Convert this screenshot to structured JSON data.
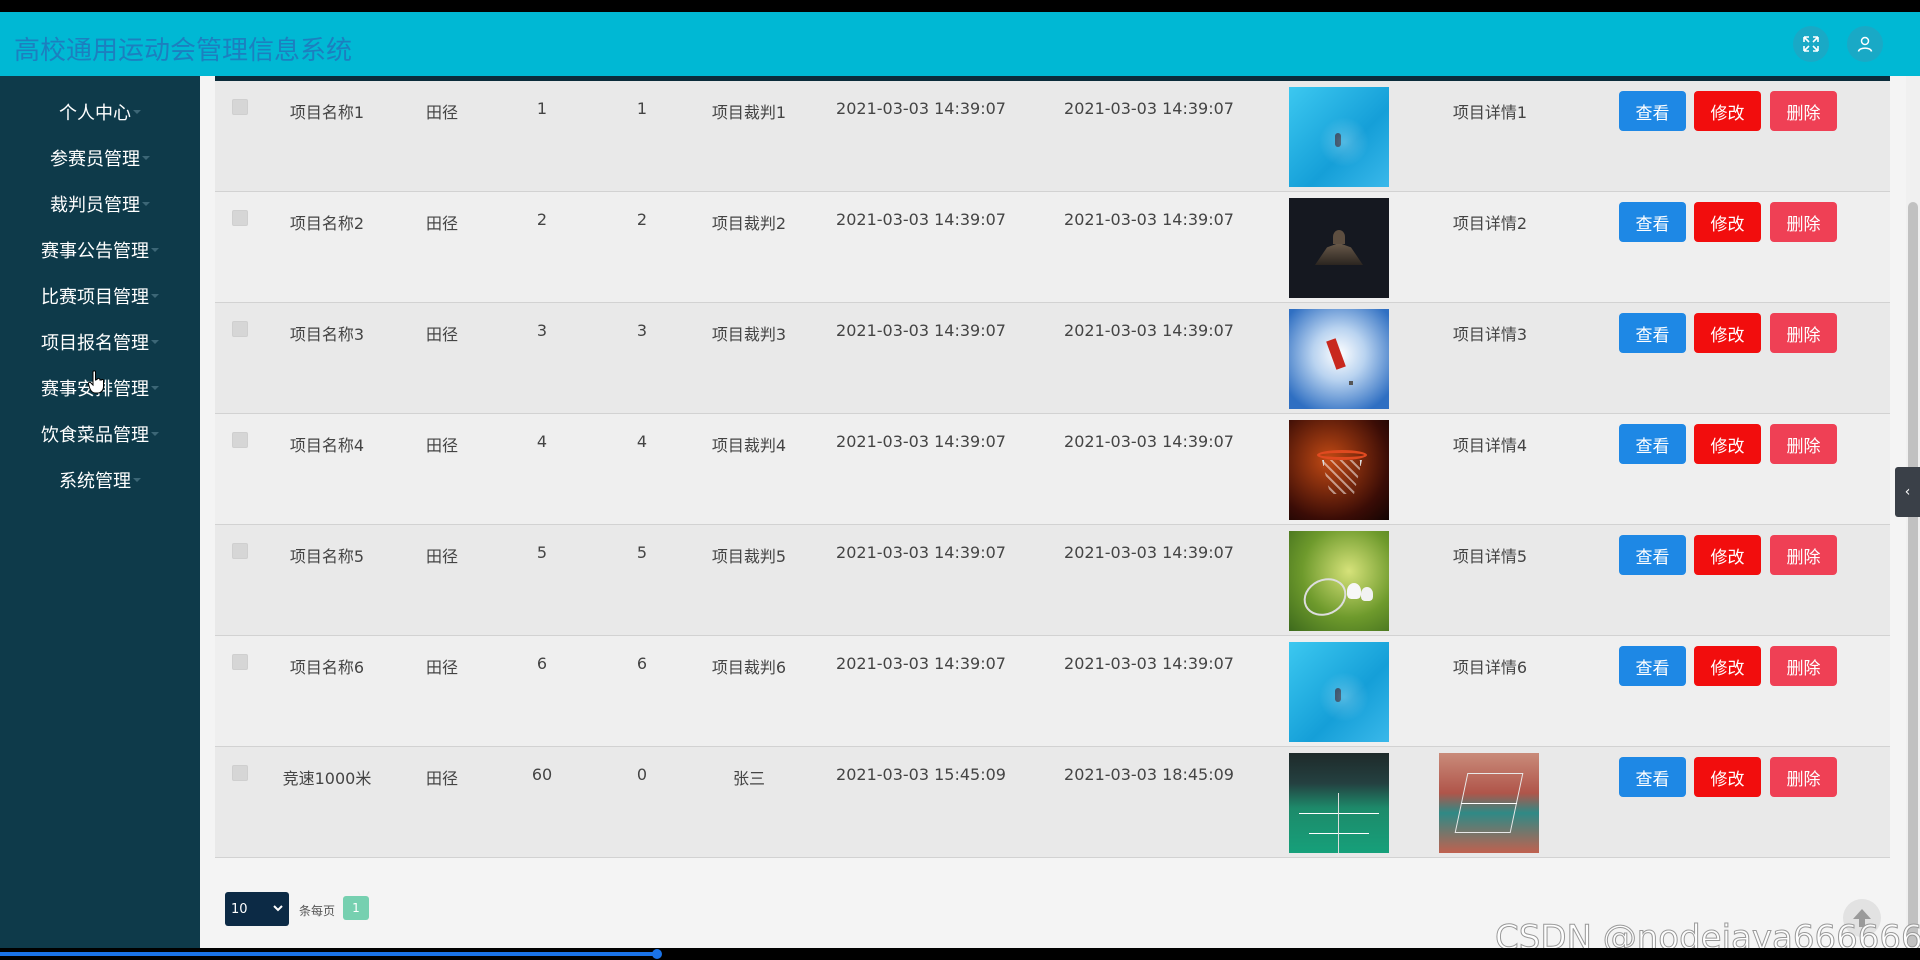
{
  "header": {
    "title": "高校通用运动会管理信息系统",
    "fullscreen_icon": "fullscreen-icon",
    "user_icon": "user-icon",
    "bg_color": "#00b8d4"
  },
  "sidebar": {
    "items": [
      {
        "label": "个人中心"
      },
      {
        "label": "参赛员管理"
      },
      {
        "label": "裁判员管理"
      },
      {
        "label": "赛事公告管理"
      },
      {
        "label": "比赛项目管理"
      },
      {
        "label": "项目报名管理"
      },
      {
        "label": "赛事安排管理"
      },
      {
        "label": "饮食菜品管理"
      },
      {
        "label": "系统管理"
      }
    ]
  },
  "table": {
    "rows": [
      {
        "name": "项目名称1",
        "type": "田径",
        "n1": "1",
        "n2": "1",
        "referee": "项目裁判1",
        "start": "2021-03-03 14:39:07",
        "end": "2021-03-03 14:39:07",
        "image": "swimming-pool-photo",
        "detail": "项目详情1"
      },
      {
        "name": "项目名称2",
        "type": "田径",
        "n1": "2",
        "n2": "2",
        "referee": "项目裁判2",
        "start": "2021-03-03 14:39:07",
        "end": "2021-03-03 14:39:07",
        "image": "dark-statue-photo",
        "detail": "项目详情2"
      },
      {
        "name": "项目名称3",
        "type": "田径",
        "n1": "3",
        "n2": "3",
        "referee": "项目裁判3",
        "start": "2021-03-03 14:39:07",
        "end": "2021-03-03 14:39:07",
        "image": "skydiver-photo",
        "detail": "项目详情3"
      },
      {
        "name": "项目名称4",
        "type": "田径",
        "n1": "4",
        "n2": "4",
        "referee": "项目裁判4",
        "start": "2021-03-03 14:39:07",
        "end": "2021-03-03 14:39:07",
        "image": "basketball-hoop-photo",
        "detail": "项目详情4"
      },
      {
        "name": "项目名称5",
        "type": "田径",
        "n1": "5",
        "n2": "5",
        "referee": "项目裁判5",
        "start": "2021-03-03 14:39:07",
        "end": "2021-03-03 14:39:07",
        "image": "badminton-photo",
        "detail": "项目详情5"
      },
      {
        "name": "项目名称6",
        "type": "田径",
        "n1": "6",
        "n2": "6",
        "referee": "项目裁判6",
        "start": "2021-03-03 14:39:07",
        "end": "2021-03-03 14:39:07",
        "image": "swimming-pool-photo",
        "detail": "项目详情6"
      },
      {
        "name": "竞速1000米",
        "type": "田径",
        "n1": "60",
        "n2": "0",
        "referee": "张三",
        "start": "2021-03-03 15:45:09",
        "end": "2021-03-03 18:45:09",
        "image": "badminton-hall-photo",
        "detail": "",
        "detail_image": "outdoor-court-photo"
      }
    ],
    "actions": {
      "view": "查看",
      "edit": "修改",
      "delete": "删除"
    }
  },
  "pagination": {
    "page_size": "10",
    "per_page_label": "条每页",
    "current_page": "1"
  },
  "watermark": "CSDN @nodejava666666"
}
